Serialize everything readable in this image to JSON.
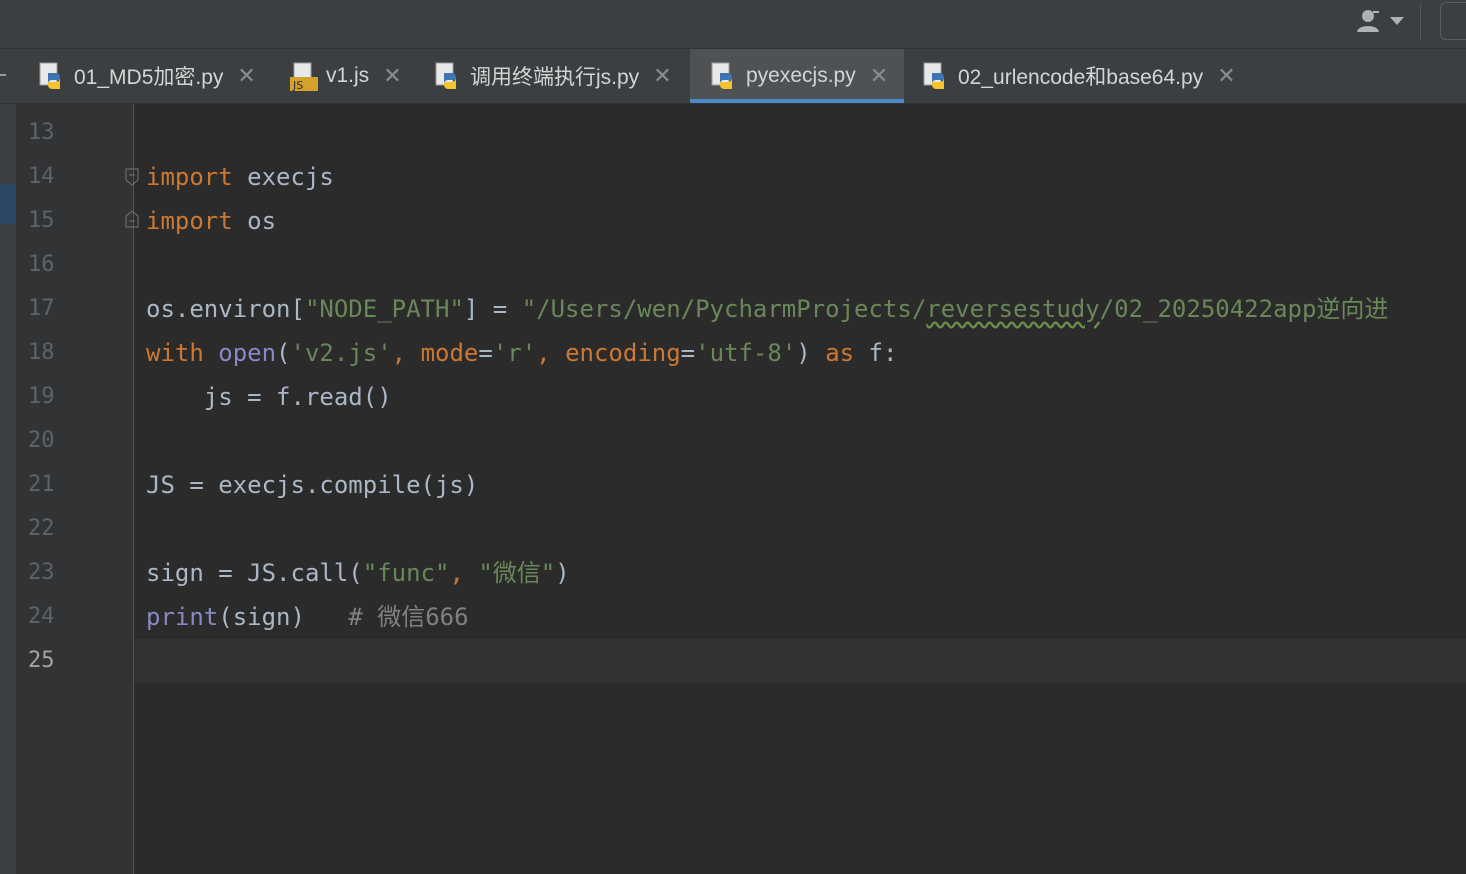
{
  "tabs": [
    {
      "label": "01_MD5加密.py",
      "type": "python",
      "active": false
    },
    {
      "label": "v1.js",
      "type": "javascript",
      "active": false
    },
    {
      "label": "调用终端执行js.py",
      "type": "python",
      "active": false
    },
    {
      "label": "pyexecjs.py",
      "type": "python",
      "active": true
    },
    {
      "label": "02_urlencode和base64.py",
      "type": "python",
      "active": false
    }
  ],
  "toolbar": {
    "user_icon": "user-icon",
    "dropdown_icon": "chevron-down-icon"
  },
  "editor": {
    "current_line": 25,
    "line_numbers": [
      "13",
      "14",
      "15",
      "16",
      "17",
      "18",
      "19",
      "20",
      "21",
      "22",
      "23",
      "24",
      "25"
    ],
    "code": {
      "l14": {
        "kw": "import",
        "rest": " execjs"
      },
      "l15": {
        "kw": "import",
        "rest": " os"
      },
      "l17": {
        "a": "os.environ[",
        "s1": "\"NODE_PATH\"",
        "b": "] = ",
        "s2": "\"/Users/wen/PycharmProjects/",
        "s3": "reversestudy",
        "s4": "/02_20250422app逆向进"
      },
      "l18": {
        "kw": "with",
        "sp1": " ",
        "fn": "open",
        "p1": "(",
        "s1": "'v2.js'",
        "c1": ", ",
        "prm1": "mode",
        "eq1": "=",
        "s2": "'r'",
        "c2": ", ",
        "prm2": "encoding",
        "eq2": "=",
        "s3": "'utf-8'",
        "p2": ") ",
        "kw2": "as",
        "rest": " f:"
      },
      "l19": {
        "text": "    js = f.read()"
      },
      "l21": {
        "text": "JS = execjs.compile(js)"
      },
      "l23": {
        "a": "sign = JS.call(",
        "s1": "\"func\"",
        "c": ", ",
        "s2": "\"微信\"",
        "b": ")"
      },
      "l24": {
        "fn": "print",
        "a": "(sign)   ",
        "cm": "# 微信666"
      }
    }
  },
  "colors": {
    "keyword": "#cc7832",
    "string": "#6a8759",
    "builtin": "#8888c6",
    "comment": "#808080",
    "text": "#a9b7c6",
    "tab_active_underline": "#4a88c7"
  }
}
